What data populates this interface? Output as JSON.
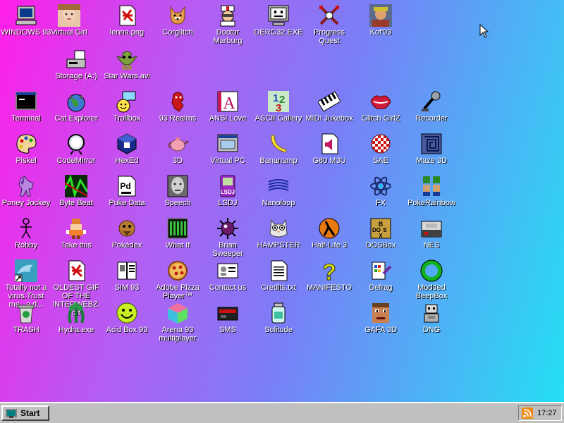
{
  "desktop": {
    "icons": [
      {
        "id": "windows93",
        "label": "WINDOWS 93"
      },
      {
        "id": "virtual-girl",
        "label": "Virtual Girl"
      },
      {
        "id": "lenna",
        "label": "lenna.png"
      },
      {
        "id": "corglitch",
        "label": "Corglitch"
      },
      {
        "id": "doctor-marburg",
        "label": "Doctor Marburg"
      },
      {
        "id": "derg32",
        "label": "DERG32.EXE"
      },
      {
        "id": "progress-quest",
        "label": "Progress Quest"
      },
      {
        "id": "kof93",
        "label": "Kof'93"
      },
      {
        "id": "storage",
        "label": "Storage (A:)"
      },
      {
        "id": "star-wars",
        "label": "Star Wars.avi"
      },
      {
        "id": "terminal",
        "label": "Terminal"
      },
      {
        "id": "cat-explorer",
        "label": "Cat Explorer"
      },
      {
        "id": "trollbox",
        "label": "Trollbox"
      },
      {
        "id": "93realms",
        "label": "93 Realms"
      },
      {
        "id": "ansi-love",
        "label": "ANSI Love"
      },
      {
        "id": "ascii-gallery",
        "label": "ASCII Gallery"
      },
      {
        "id": "midi-jukebox",
        "label": "MIDI Jukebox"
      },
      {
        "id": "glitch-girlz",
        "label": "Glitch GirlZ"
      },
      {
        "id": "recorder",
        "label": "Recorder"
      },
      {
        "id": "piskel",
        "label": "Piskel"
      },
      {
        "id": "codemirror",
        "label": "CodeMirror"
      },
      {
        "id": "hexed",
        "label": "HexEd"
      },
      {
        "id": "3d",
        "label": "3D"
      },
      {
        "id": "virtual-pc",
        "label": "Virtual PC"
      },
      {
        "id": "bananamp",
        "label": "Bananamp"
      },
      {
        "id": "g80m3u",
        "label": "G80.M3U"
      },
      {
        "id": "sae",
        "label": "SAE"
      },
      {
        "id": "maze3d",
        "label": "Maze 3D"
      },
      {
        "id": "poney-jockey",
        "label": "Poney Jockey"
      },
      {
        "id": "byte-beat",
        "label": "Byte Beat"
      },
      {
        "id": "puke-data",
        "label": "Puke Data"
      },
      {
        "id": "speech",
        "label": "Speech"
      },
      {
        "id": "lsdj",
        "label": "LSDJ"
      },
      {
        "id": "nanoloop",
        "label": "Nanoloop"
      },
      {
        "id": "fx",
        "label": "FX"
      },
      {
        "id": "pokerainbow",
        "label": "PokeRainbow"
      },
      {
        "id": "robby",
        "label": "Robby"
      },
      {
        "id": "take-this",
        "label": "Take this"
      },
      {
        "id": "pokedex",
        "label": "Pokédex"
      },
      {
        "id": "what-if",
        "label": "What If"
      },
      {
        "id": "brian-sweeper",
        "label": "Brian Sweeper"
      },
      {
        "id": "hampster",
        "label": "HAMPSTER"
      },
      {
        "id": "half-life3",
        "label": "Half-Life 3"
      },
      {
        "id": "dosbox",
        "label": "DOSBox"
      },
      {
        "id": "nes",
        "label": "NES"
      },
      {
        "id": "totally-not-virus",
        "label": "Totally not a virus.Trust me...a d..."
      },
      {
        "id": "oldest-gif",
        "label": "OLDEST GIF OF THE INTERWEBZ.gif"
      },
      {
        "id": "sim93",
        "label": "SIM 93"
      },
      {
        "id": "adobe-pizza",
        "label": "Adobe Pizza Player™"
      },
      {
        "id": "contact-us",
        "label": "Contact us"
      },
      {
        "id": "credits",
        "label": "Credits.txt"
      },
      {
        "id": "manifesto",
        "label": "MANIFESTO"
      },
      {
        "id": "defrag",
        "label": "Defrag"
      },
      {
        "id": "modded-beepbox",
        "label": "Modded BeepBox"
      },
      {
        "id": "trash",
        "label": "TRASH"
      },
      {
        "id": "hydra",
        "label": "Hydra.exe"
      },
      {
        "id": "acid-box",
        "label": "Acid Box 93"
      },
      {
        "id": "arena93",
        "label": "Arena 93 multiplayer"
      },
      {
        "id": "sms",
        "label": "SMS"
      },
      {
        "id": "solitude",
        "label": "Solitude"
      },
      {
        "id": "gafa3d",
        "label": "GAFA 3D"
      },
      {
        "id": "dng",
        "label": "DNG"
      }
    ]
  },
  "taskbar": {
    "start_label": "Start",
    "clock": "17:27"
  }
}
